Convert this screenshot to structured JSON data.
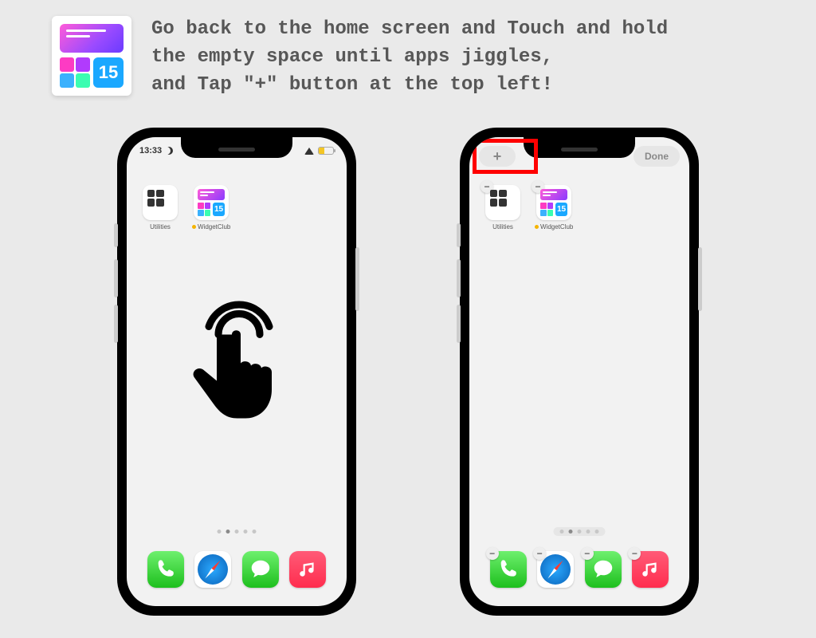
{
  "header": {
    "icon_calendar_num": "15",
    "instruction": "Go back to the home screen and Touch and hold\nthe empty space until apps jiggles,\nand Tap \"+\" button at the top left!"
  },
  "phone_a": {
    "time": "13:33",
    "apps": [
      {
        "id": "utilities",
        "label": "Utilities"
      },
      {
        "id": "widgetclub",
        "label": "WidgetClub",
        "mini_cal": "15",
        "has_download_dot": true
      }
    ],
    "page_dots": {
      "count": 5,
      "active_index": 1
    },
    "dock": [
      "phone",
      "safari",
      "messages",
      "music"
    ]
  },
  "phone_b": {
    "plus_label": "+",
    "done_label": "Done",
    "apps": [
      {
        "id": "utilities",
        "label": "Utilities"
      },
      {
        "id": "widgetclub",
        "label": "WidgetClub",
        "mini_cal": "15",
        "has_download_dot": true
      }
    ],
    "page_dots": {
      "count": 5,
      "active_index": 1
    },
    "dock": [
      "phone",
      "safari",
      "messages",
      "music"
    ]
  }
}
